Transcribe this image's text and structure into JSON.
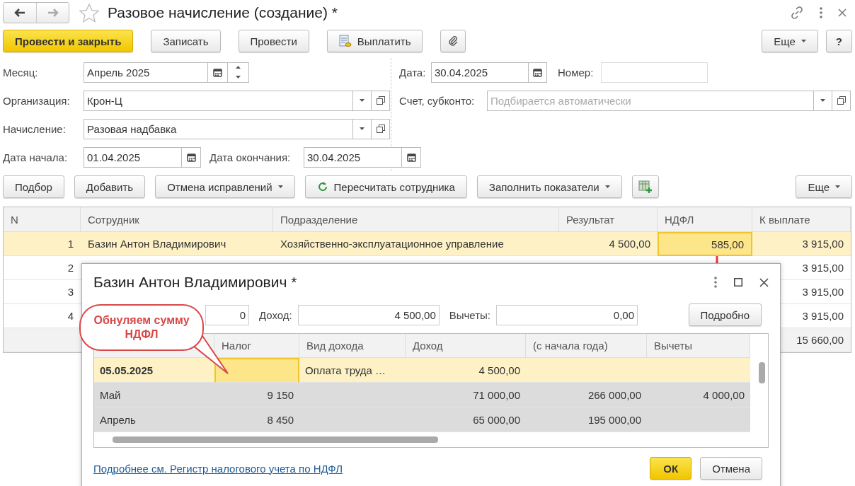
{
  "window": {
    "title": "Разовое начисление (создание) *"
  },
  "toolbar": {
    "buttons": [
      {
        "kind": "primary",
        "label": "Провести и закрыть"
      },
      {
        "kind": "plain",
        "label": "Записать"
      },
      {
        "kind": "plain",
        "label": "Провести"
      },
      {
        "kind": "pay",
        "label": "Выплатить"
      },
      {
        "kind": "attach"
      }
    ],
    "more": "Еще",
    "help": "?"
  },
  "form": {
    "month": {
      "label": "Месяц:",
      "value": "Апрель 2025"
    },
    "organization": {
      "label": "Организация:",
      "value": "Крон-Ц"
    },
    "accrual": {
      "label": "Начисление:",
      "value": "Разовая надбавка"
    },
    "start_date": {
      "label": "Дата начала:",
      "value": "01.04.2025"
    },
    "end_date": {
      "label": "Дата окончания:",
      "value": "30.04.2025"
    },
    "date": {
      "label": "Дата:",
      "value": "30.04.2025"
    },
    "number": {
      "label": "Номер:"
    },
    "account": {
      "label": "Счет, субконто:",
      "placeholder": "Подбирается автоматически"
    }
  },
  "table_toolbar": {
    "buttons": [
      {
        "kind": "plain",
        "label": "Подбор"
      },
      {
        "kind": "plain",
        "label": "Добавить"
      },
      {
        "kind": "dropdown",
        "label": "Отмена исправлений"
      },
      {
        "kind": "refresh",
        "label": "Пересчитать сотрудника"
      },
      {
        "kind": "dropdown",
        "label": "Заполнить показатели"
      },
      {
        "kind": "table_add"
      }
    ],
    "more": "Еще"
  },
  "table": {
    "columns": [
      "N",
      "Сотрудник",
      "Подразделение",
      "Результат",
      "НДФЛ",
      "К выплате"
    ],
    "rows": [
      {
        "n": "1",
        "employee": "Базин Антон Владимирович",
        "department": "Хозяйственно-эксплуатационное управление",
        "result": "4 500,00",
        "ndfl": "585,00",
        "pay": "3 915,00",
        "selected": true,
        "ndfl_focused": true
      },
      {
        "n": "2",
        "pay": "3 915,00",
        "selected": false
      },
      {
        "n": "3",
        "pay": "3 915,00",
        "selected": false
      },
      {
        "n": "4",
        "pay": "3 915,00",
        "selected": false
      }
    ],
    "total_pay": "15 660,00"
  },
  "dialog": {
    "title": "Базин Антон Владимирович *",
    "fields": [
      {
        "value": "0"
      },
      {
        "label": "Доход:",
        "value": "4 500,00"
      },
      {
        "label": "Вычеты:",
        "value": "0,00"
      }
    ],
    "details_button": "Подробно",
    "columns": [
      "Налог",
      "Вид дохода",
      "Доход",
      "(с начала года)",
      "Вычеты"
    ],
    "rows": [
      {
        "kind": "entry",
        "period": "05.05.2025",
        "income_type": "Оплата труда …",
        "income": "4 500,00",
        "selected": true,
        "tax_focused": true
      },
      {
        "kind": "month",
        "period": "Май",
        "tax": "9 150",
        "income": "71 000,00",
        "income_ytd": "266 000,00",
        "deductions": "4 000,00",
        "selected": false,
        "tax_focused": false
      },
      {
        "kind": "month",
        "period": "Апрель",
        "tax": "8 450",
        "income": "65 000,00",
        "income_ytd": "195 000,00",
        "selected": false,
        "tax_focused": false
      }
    ],
    "link": "Подробнее см. Регистр налогового учета по НДФЛ",
    "ok": "ОК",
    "cancel": "Отмена"
  },
  "callout": {
    "text": "Обнуляем сумму НДФЛ"
  }
}
